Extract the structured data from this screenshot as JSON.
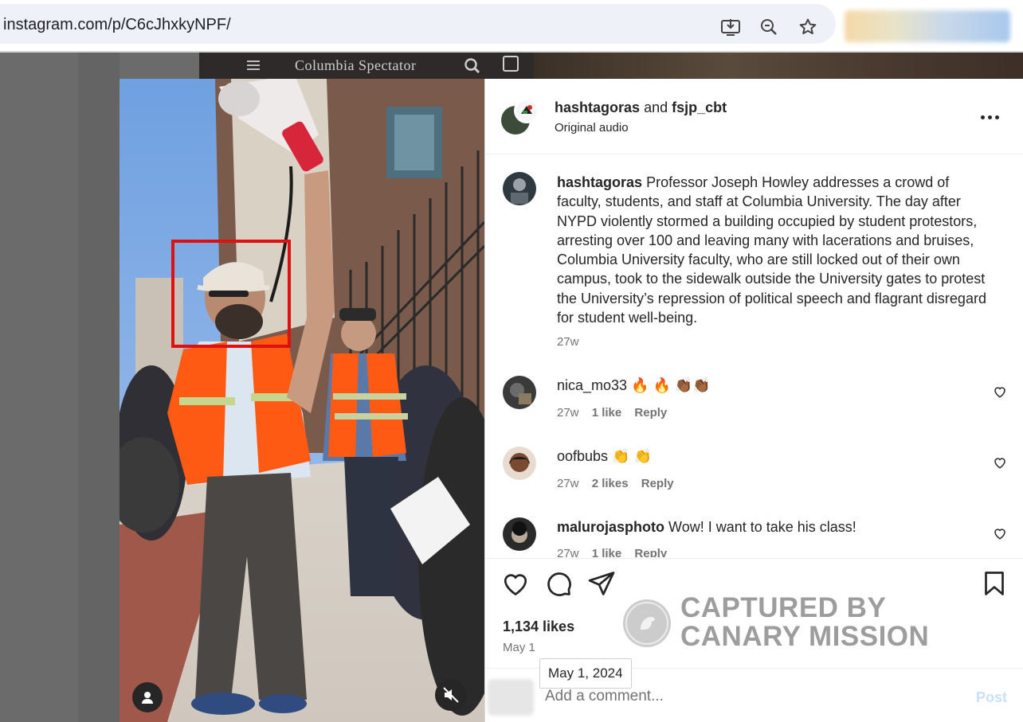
{
  "browser": {
    "url": "instagram.com/p/C6cJhxkyNPF/",
    "icons": [
      "install-app-icon",
      "zoom-icon",
      "bookmark-star-icon"
    ]
  },
  "background_site": {
    "logo": "Columbia Spectator"
  },
  "post": {
    "author": "hashtagoras",
    "and_text": "and",
    "collaborator": "fsjp_cbt",
    "audio": "Original audio",
    "caption_user": "hashtagoras",
    "caption": "Professor Joseph Howley addresses a crowd of faculty, students, and staff at Columbia University. The day after NYPD violently stormed a building occupied by student protestors, arresting over 100 and leaving many with lacerations and bruises, Columbia University faculty, who are still locked out of their own campus, took to the sidewalk outside the University gates to protest the University’s repression of political speech and flagrant disregard for student well-being.",
    "caption_time": "27w",
    "likes": "1,134 likes",
    "date_short": "May 1",
    "date_tooltip": "May 1, 2024",
    "add_comment_placeholder": "Add a comment...",
    "post_button": "Post"
  },
  "comments": [
    {
      "user": "nica_mo33",
      "text": "🔥 🔥 👏🏾👏🏾",
      "time": "27w",
      "likes": "1 like",
      "reply": "Reply"
    },
    {
      "user": "oofbubs",
      "text": "👏 👏",
      "time": "27w",
      "likes": "2 likes",
      "reply": "Reply"
    },
    {
      "user": "malurojasphoto",
      "text": "Wow! I want to take his class!",
      "time": "27w",
      "likes": "1 like",
      "reply": "Reply"
    }
  ],
  "watermark": {
    "line1": "CAPTURED BY",
    "line2": "CANARY MISSION"
  },
  "colors": {
    "link_disabled": "#c8e1fd",
    "secondary_text": "#737373",
    "highlight_box": "#e01010"
  }
}
